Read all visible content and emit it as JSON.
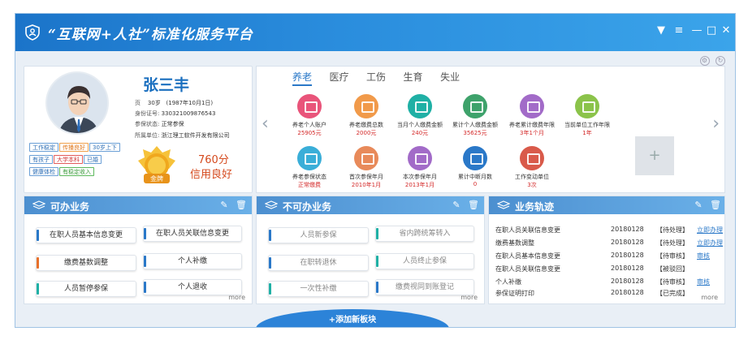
{
  "window": {
    "title": "“互联网+人社”标准化服务平台",
    "controls": [
      "▼",
      "≡",
      "—",
      "□",
      "✕"
    ]
  },
  "profile": {
    "name": "张三丰",
    "age_label": "页",
    "age": "30岁",
    "birth": "(1987年10月1日)",
    "id_label": "身份证号:",
    "id_number": "330321009876543",
    "status_label": "参保状态:",
    "status": "正常参保",
    "employer_label": "所属单位:",
    "employer": "浙江理工软件开发有限公司",
    "tags": [
      {
        "text": "工作稳定",
        "color": "blue"
      },
      {
        "text": "传播良好",
        "color": "orange"
      },
      {
        "text": "30岁上下",
        "color": "blue"
      },
      {
        "text": "有孩子",
        "color": "blue"
      },
      {
        "text": "大学本科",
        "color": "red"
      },
      {
        "text": "已婚",
        "color": "blue"
      },
      {
        "text": "健康体检",
        "color": "blue"
      },
      {
        "text": "有稳定收入",
        "color": "green"
      }
    ],
    "medal_text": "金牌",
    "score": "760分",
    "credit": "信用良好"
  },
  "services": {
    "tabs": [
      "养老",
      "医疗",
      "工伤",
      "生育",
      "失业"
    ],
    "active_tab": 0,
    "items": [
      {
        "label": "养老个人账户",
        "value": "25905元",
        "color": "#e9547a"
      },
      {
        "label": "养老缴费总数",
        "value": "2000元",
        "color": "#f19a4a"
      },
      {
        "label": "当月个人缴费金额",
        "value": "240元",
        "color": "#1fb0a5"
      },
      {
        "label": "累计个人缴费金额",
        "value": "35625元",
        "color": "#3ea26b"
      },
      {
        "label": "养老累计缴费年限",
        "value": "3年1个月",
        "color": "#a26bc8"
      },
      {
        "label": "当前单位工作年限",
        "value": "1年",
        "color": "#8bc34a"
      },
      {
        "label": "养老参保状态",
        "value": "正常缴费",
        "color": "#3aaed8"
      },
      {
        "label": "首次参保年月",
        "value": "2010年1月",
        "color": "#e88a5a"
      },
      {
        "label": "本次参保年月",
        "value": "2013年1月",
        "color": "#a26bc8"
      },
      {
        "label": "累计中断月数",
        "value": "0",
        "color": "#2a78c8"
      },
      {
        "label": "工作变动单位",
        "value": "3次",
        "color": "#d95a4a"
      }
    ],
    "add_label": "+"
  },
  "panel_todo": {
    "title": "可办业务",
    "items": [
      "在职人员基本信息变更",
      "在职人员关联信息变更",
      "缴费基数调整",
      "个人补缴",
      "人员暂停参保",
      "个人退收"
    ],
    "more": "more"
  },
  "panel_no": {
    "title": "不可办业务",
    "items": [
      "人员新参保",
      "省内跨统筹转入",
      "在职转退休",
      "人员终止参保",
      "一次性补缴",
      "缴费视同到账登记"
    ],
    "more": "more"
  },
  "panel_track": {
    "title": "业务轨迹",
    "rows": [
      {
        "name": "在职人员关联信息变更",
        "date": "20180128",
        "status": "【待处理】",
        "action": "立即办理"
      },
      {
        "name": "缴费基数调整",
        "date": "20180128",
        "status": "【待处理】",
        "action": "立即办理"
      },
      {
        "name": "在职人员基本信息变更",
        "date": "20180128",
        "status": "【待审核】",
        "action": "审核"
      },
      {
        "name": "在职人员关联信息变更",
        "date": "20180128",
        "status": "【被驳回】",
        "action": ""
      },
      {
        "name": "个人补缴",
        "date": "20180128",
        "status": "【待审核】",
        "action": "审核"
      },
      {
        "name": "参保证明打印",
        "date": "20180128",
        "status": "【已完成】",
        "action": ""
      }
    ],
    "more": "more"
  },
  "add_block": "+添加新板块"
}
